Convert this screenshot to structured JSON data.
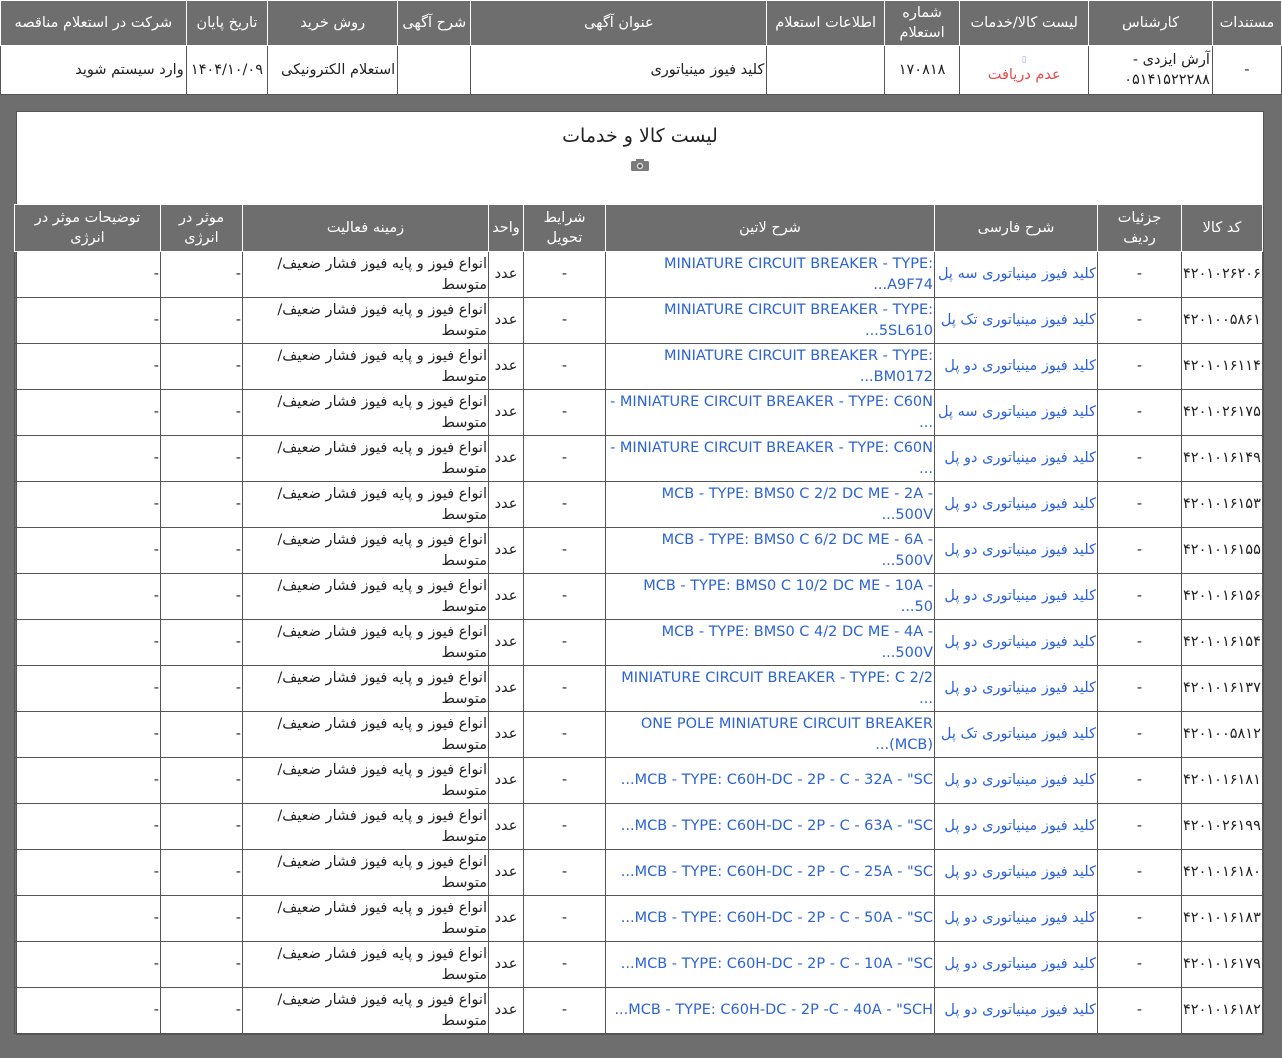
{
  "top": {
    "headers": [
      "مستندات",
      "کارشناس",
      "لیست کالا/خدمات",
      "شماره استعلام",
      "اطلاعات استعلام",
      "عنوان آگهی",
      "شرح آگهی",
      "روش خرید",
      "تاریخ پایان",
      "شرکت در استعلام مناقصه"
    ],
    "row": {
      "documents": "-",
      "expert": "آرش ایزدی - ۰۵۱۴۱۵۲۲۲۸۸",
      "items_glyph": "▯",
      "items_status": "عدم دریافت",
      "inquiry_number": "۱۷۰۸۱۸",
      "inquiry_info": "",
      "ad_title": "کلید فیوز مینیاتوری",
      "ad_desc": "",
      "purchase_method": "استعلام الکترونیکی",
      "end_date": "۱۴۰۴/۱۰/۰۹",
      "participate": "وارد سیستم شوید"
    }
  },
  "panel": {
    "title": "لیست کالا و خدمات",
    "camera_icon": "camera-icon",
    "headers": [
      "کد کالا",
      "جزئیات ردیف",
      "شرح فارسی",
      "شرح لاتین",
      "شرایط تحویل",
      "واحد",
      "زمینه فعالیت",
      "موثر در انرژی",
      "توضیحات موثر در انرژی"
    ],
    "rows": [
      {
        "code": "۴۲۰۱۰۲۶۲۰۶",
        "details": "-",
        "fa": "کلید فیوز مینیاتوری سه پل",
        "latin": "MINIATURE CIRCUIT BREAKER - TYPE: A9F74...",
        "delivery": "-",
        "unit": "عدد",
        "field": "انواع فیوز و پایه فیوز فشار ضعیف/متوسط",
        "energy": "-",
        "energy_desc": "-"
      },
      {
        "code": "۴۲۰۱۰۰۵۸۶۱",
        "details": "-",
        "fa": "کلید فیوز مینیاتوری تک پل",
        "latin": "MINIATURE CIRCUIT BREAKER - TYPE: 5SL610...",
        "delivery": "-",
        "unit": "عدد",
        "field": "انواع فیوز و پایه فیوز فشار ضعیف/متوسط",
        "energy": "-",
        "energy_desc": "-"
      },
      {
        "code": "۴۲۰۱۰۱۶۱۱۴",
        "details": "-",
        "fa": "کلید فیوز مینیاتوری دو پل",
        "latin": "MINIATURE CIRCUIT BREAKER - TYPE: BM0172...",
        "delivery": "-",
        "unit": "عدد",
        "field": "انواع فیوز و پایه فیوز فشار ضعیف/متوسط",
        "energy": "-",
        "energy_desc": "-"
      },
      {
        "code": "۴۲۰۱۰۲۶۱۷۵",
        "details": "-",
        "fa": "کلید فیوز مینیاتوری سه پل",
        "latin": "MINIATURE CIRCUIT BREAKER - TYPE: C60N - ...",
        "delivery": "-",
        "unit": "عدد",
        "field": "انواع فیوز و پایه فیوز فشار ضعیف/متوسط",
        "energy": "-",
        "energy_desc": "-"
      },
      {
        "code": "۴۲۰۱۰۱۶۱۴۹",
        "details": "-",
        "fa": "کلید فیوز مینیاتوری دو پل",
        "latin": "MINIATURE CIRCUIT BREAKER - TYPE: C60N - ...",
        "delivery": "-",
        "unit": "عدد",
        "field": "انواع فیوز و پایه فیوز فشار ضعیف/متوسط",
        "energy": "-",
        "energy_desc": "-"
      },
      {
        "code": "۴۲۰۱۰۱۶۱۵۳",
        "details": "-",
        "fa": "کلید فیوز مینیاتوری دو پل",
        "latin": "MCB - TYPE: BMS0 C 2/2 DC ME - 2A - 500V...",
        "delivery": "-",
        "unit": "عدد",
        "field": "انواع فیوز و پایه فیوز فشار ضعیف/متوسط",
        "energy": "-",
        "energy_desc": "-"
      },
      {
        "code": "۴۲۰۱۰۱۶۱۵۵",
        "details": "-",
        "fa": "کلید فیوز مینیاتوری دو پل",
        "latin": "MCB - TYPE: BMS0 C 6/2 DC ME - 6A - 500V...",
        "delivery": "-",
        "unit": "عدد",
        "field": "انواع فیوز و پایه فیوز فشار ضعیف/متوسط",
        "energy": "-",
        "energy_desc": "-"
      },
      {
        "code": "۴۲۰۱۰۱۶۱۵۶",
        "details": "-",
        "fa": "کلید فیوز مینیاتوری دو پل",
        "latin": "MCB - TYPE: BMS0 C 10/2 DC ME - 10A - 50...",
        "delivery": "-",
        "unit": "عدد",
        "field": "انواع فیوز و پایه فیوز فشار ضعیف/متوسط",
        "energy": "-",
        "energy_desc": "-"
      },
      {
        "code": "۴۲۰۱۰۱۶۱۵۴",
        "details": "-",
        "fa": "کلید فیوز مینیاتوری دو پل",
        "latin": "MCB - TYPE: BMS0 C 4/2 DC ME - 4A - 500V...",
        "delivery": "-",
        "unit": "عدد",
        "field": "انواع فیوز و پایه فیوز فشار ضعیف/متوسط",
        "energy": "-",
        "energy_desc": "-"
      },
      {
        "code": "۴۲۰۱۰۱۶۱۳۷",
        "details": "-",
        "fa": "کلید فیوز مینیاتوری دو پل",
        "latin": "MINIATURE CIRCUIT BREAKER - TYPE: C 2/2 ...",
        "delivery": "-",
        "unit": "عدد",
        "field": "انواع فیوز و پایه فیوز فشار ضعیف/متوسط",
        "energy": "-",
        "energy_desc": "-"
      },
      {
        "code": "۴۲۰۱۰۰۵۸۱۲",
        "details": "-",
        "fa": "کلید فیوز مینیاتوری تک پل",
        "latin": "ONE POLE MINIATURE CIRCUIT BREAKER (MCB)...",
        "delivery": "-",
        "unit": "عدد",
        "field": "انواع فیوز و پایه فیوز فشار ضعیف/متوسط",
        "energy": "-",
        "energy_desc": "-"
      },
      {
        "code": "۴۲۰۱۰۱۶۱۸۱",
        "details": "-",
        "fa": "کلید فیوز مینیاتوری دو پل",
        "latin": "MCB - TYPE: C60H-DC - 2P - C - 32A - \"SC...",
        "delivery": "-",
        "unit": "عدد",
        "field": "انواع فیوز و پایه فیوز فشار ضعیف/متوسط",
        "energy": "-",
        "energy_desc": "-"
      },
      {
        "code": "۴۲۰۱۰۲۶۱۹۹",
        "details": "-",
        "fa": "کلید فیوز مینیاتوری دو پل",
        "latin": "MCB - TYPE: C60H-DC - 2P - C - 63A - \"SC...",
        "delivery": "-",
        "unit": "عدد",
        "field": "انواع فیوز و پایه فیوز فشار ضعیف/متوسط",
        "energy": "-",
        "energy_desc": "-"
      },
      {
        "code": "۴۲۰۱۰۱۶۱۸۰",
        "details": "-",
        "fa": "کلید فیوز مینیاتوری دو پل",
        "latin": "MCB - TYPE: C60H-DC - 2P - C - 25A - \"SC...",
        "delivery": "-",
        "unit": "عدد",
        "field": "انواع فیوز و پایه فیوز فشار ضعیف/متوسط",
        "energy": "-",
        "energy_desc": "-"
      },
      {
        "code": "۴۲۰۱۰۱۶۱۸۳",
        "details": "-",
        "fa": "کلید فیوز مینیاتوری دو پل",
        "latin": "MCB - TYPE: C60H-DC - 2P - C - 50A - \"SC...",
        "delivery": "-",
        "unit": "عدد",
        "field": "انواع فیوز و پایه فیوز فشار ضعیف/متوسط",
        "energy": "-",
        "energy_desc": "-"
      },
      {
        "code": "۴۲۰۱۰۱۶۱۷۹",
        "details": "-",
        "fa": "کلید فیوز مینیاتوری دو پل",
        "latin": "MCB - TYPE: C60H-DC - 2P - C - 10A - \"SC...",
        "delivery": "-",
        "unit": "عدد",
        "field": "انواع فیوز و پایه فیوز فشار ضعیف/متوسط",
        "energy": "-",
        "energy_desc": "-"
      },
      {
        "code": "۴۲۰۱۰۱۶۱۸۲",
        "details": "-",
        "fa": "کلید فیوز مینیاتوری دو پل",
        "latin": "MCB - TYPE: C60H-DC - 2P -C - 40A - \"SCH...",
        "delivery": "-",
        "unit": "عدد",
        "field": "انواع فیوز و پایه فیوز فشار ضعیف/متوسط",
        "energy": "-",
        "energy_desc": "-"
      }
    ]
  },
  "colors": {
    "header_bg": "#6e6e6e",
    "link": "#2c63d6",
    "status_red": "#e84a4a"
  }
}
